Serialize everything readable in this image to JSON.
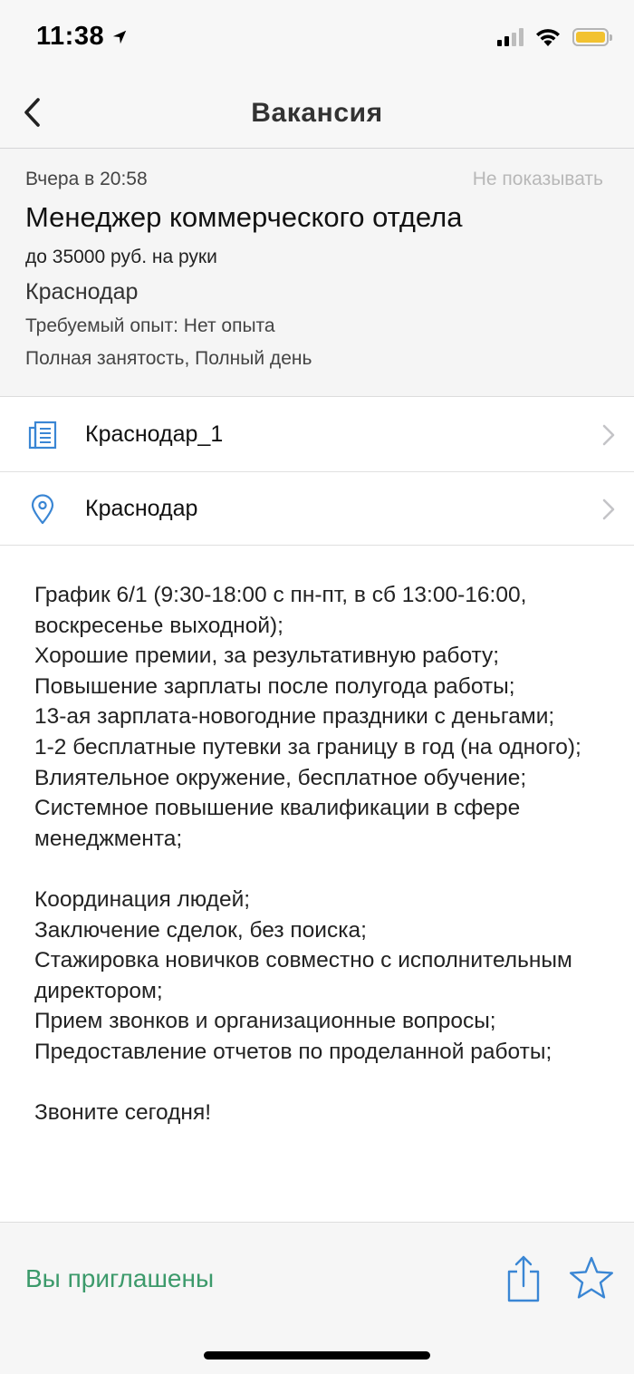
{
  "status_bar": {
    "time": "11:38",
    "battery_color": "#f2c230"
  },
  "nav": {
    "title": "Вакансия",
    "back_icon": "chevron-left-icon"
  },
  "vacancy": {
    "posted": "Вчера в 20:58",
    "hide_label": "Не показывать",
    "title": "Менеджер коммерческого отдела",
    "salary": "до 35000 руб. на руки",
    "city": "Краснодар",
    "experience": "Требуемый опыт: Нет опыта",
    "employment": "Полная занятость, Полный день"
  },
  "rows": [
    {
      "icon": "company-building-icon",
      "label": "Краснодар_1"
    },
    {
      "icon": "location-pin-icon",
      "label": "Краснодар"
    }
  ],
  "description": [
    "График 6/1 (9:30-18:00 с пн-пт, в сб 13:00-16:00, воскресенье выходной);",
    "Хорошие премии, за результативную работу;",
    "Повышение зарплаты после полугода работы;",
    "13-ая зарплата-новогодние праздники с деньгами;",
    "1-2 бесплатные путевки за границу в год (на одного);",
    "Влиятельное окружение, бесплатное обучение;",
    "Системное повышение квалификации в сфере менеджмента;",
    "",
    "Координация людей;",
    "Заключение сделок, без поиска;",
    "Стажировка новичков совместно с исполнительным директором;",
    "Прием звонков и организационные вопросы;",
    "Предоставление отчетов по проделанной работы;",
    "",
    "Звоните сегодня!"
  ],
  "bottom_bar": {
    "status": "Вы приглашены",
    "status_color": "#3c9a6b",
    "share_icon": "share-icon",
    "favorite_icon": "star-icon",
    "accent_color": "#3a86d4"
  }
}
